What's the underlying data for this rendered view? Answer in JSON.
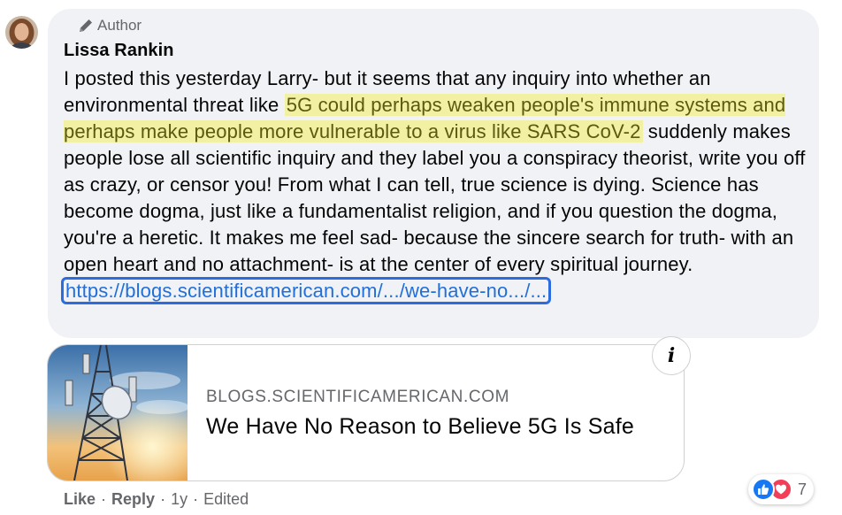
{
  "comment": {
    "badge_label": "Author",
    "commenter_name": "Lissa Rankin",
    "text_before": "I posted this yesterday Larry- but it seems that any inquiry into whether an environmental threat like ",
    "text_highlight": "5G could perhaps weaken people's immune systems and perhaps make people more vulnerable to a virus like SARS CoV-2",
    "text_after": " suddenly makes people lose all scientific inquiry and they label you a conspiracy theorist, write you off as crazy, or censor you! From what I can tell, true science is dying. Science has become dogma, just like a fundamentalist religion, and if you question the dogma, you're a heretic. It makes me feel sad- because the sincere search for truth- with an open heart and no attachment- is at the center of every spiritual journey.",
    "link_text": "https://blogs.scientificamerican.com/.../we-have-no.../..."
  },
  "preview": {
    "domain": "BLOGS.SCIENTIFICAMERICAN.COM",
    "title": "We Have No Reason to Believe 5G Is Safe",
    "info_label": "i"
  },
  "actions": {
    "like": "Like",
    "reply": "Reply",
    "time": "1y",
    "edited": "Edited",
    "separator": "·"
  },
  "reactions": {
    "count": "7",
    "types": [
      "like-icon",
      "love-icon"
    ]
  },
  "colors": {
    "bubble_bg": "#f0f2f5",
    "highlight_bg": "#f1f0a3",
    "link": "#216fdb",
    "secondary_text": "#65676b",
    "like_blue": "#1877f2",
    "love_red": "#f33e58"
  }
}
